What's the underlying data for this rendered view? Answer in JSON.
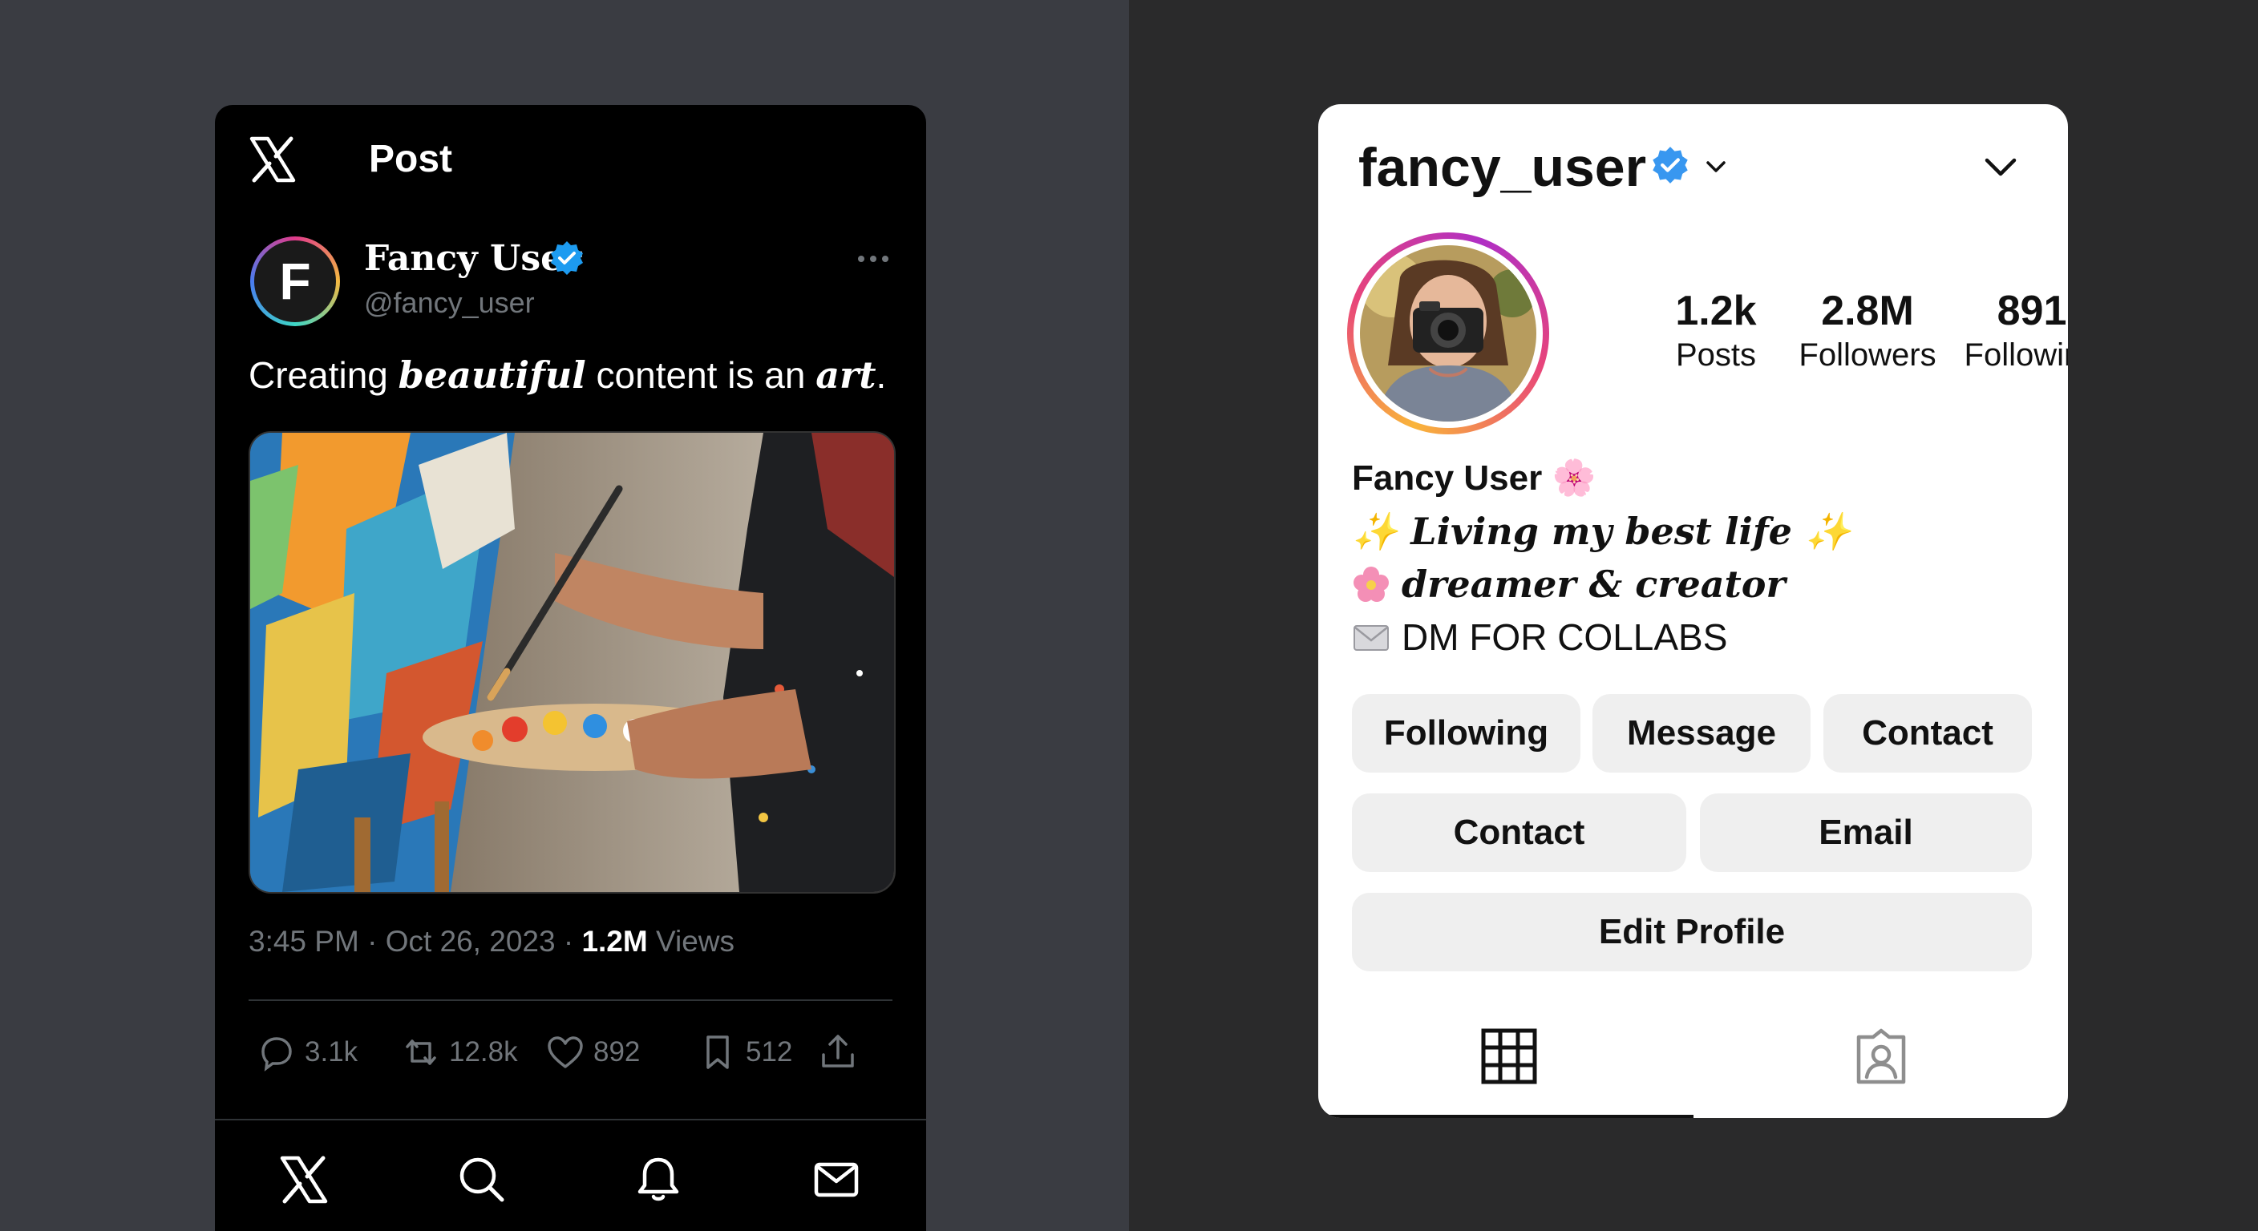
{
  "x_post": {
    "header_title": "Post",
    "author": {
      "name": "Fancy User",
      "handle": "@fancy_user",
      "avatar_letter": "F"
    },
    "text": {
      "part1": "Creating ",
      "emph1": "beautiful",
      "part2": " content is an ",
      "emph2": "art",
      "part3": "."
    },
    "meta": {
      "time": "3:45 PM",
      "date": "Oct 26, 2023",
      "views_count": "1.2M",
      "views_label": "Views",
      "sep": "·"
    },
    "actions": {
      "replies": "3.1k",
      "reposts": "12.8k",
      "likes": "892",
      "bookmarks": "512"
    },
    "colors": {
      "background": "#000000",
      "verified": "#1d9bf0",
      "muted": "#71767b"
    }
  },
  "ig_profile": {
    "username": "fancy_user",
    "stats": [
      {
        "value": "1.2k",
        "label": "Posts"
      },
      {
        "value": "2.8M",
        "label": "Followers"
      },
      {
        "value": "891",
        "label": "Following"
      }
    ],
    "full_name": "Fancy User 🌸",
    "bio": {
      "line1": "✨ Living my best life ✨",
      "line2": "dreamer & creator",
      "line3": "DM FOR COLLABS"
    },
    "buttons": {
      "following": "Following",
      "message": "Message",
      "contact1": "Contact",
      "contact2": "Contact",
      "email": "Email",
      "edit_profile": "Edit Profile"
    },
    "tabs": [
      "grid-icon",
      "tagged-icon"
    ],
    "colors": {
      "verified": "#3897f0",
      "button_bg": "#efefef"
    }
  }
}
